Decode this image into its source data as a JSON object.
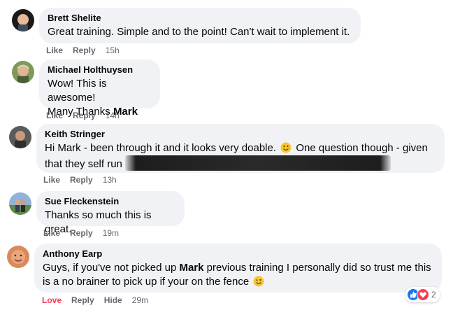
{
  "comments": [
    {
      "author": "Brett Shelite",
      "lines": [
        "Great training. Simple and to the point! Can't wait to implement it."
      ],
      "actions": {
        "like": "Like",
        "reply": "Reply",
        "time": "15h"
      }
    },
    {
      "author": "Michael Holthuysen",
      "line1": "Wow! This is awesome!",
      "line2_prefix": "Many Thanks ",
      "line2_mention": "Mark",
      "actions": {
        "like": "Like",
        "reply": "Reply",
        "time": "14h"
      }
    },
    {
      "author": "Keith Stringer",
      "line1_a": "Hi Mark - been through it and it looks very doable.",
      "line1_b": "One question though - given",
      "line2": "that they self run",
      "actions": {
        "like": "Like",
        "reply": "Reply",
        "time": "13h"
      }
    },
    {
      "author": "Sue Fleckenstein",
      "line1": "Thanks so much this is great.",
      "actions": {
        "like": "Like",
        "reply": "Reply",
        "time": "19m"
      }
    },
    {
      "author": "Anthony Earp",
      "line1_a": "Guys, if you've not picked up ",
      "line1_mention": "Mark",
      "line1_b": " previous training I personally did so trust me this",
      "line2": "is a no brainer to pick up if your on the fence",
      "actions": {
        "like": "Love",
        "reply": "Reply",
        "hide": "Hide",
        "time": "29m"
      },
      "reactions": {
        "icons": [
          "like-icon",
          "love-icon"
        ],
        "count": "2"
      }
    }
  ],
  "colors": {
    "bubble": "#f0f2f5",
    "meta": "#65676b",
    "love": "#f33e58",
    "like_blue": "#1877f2"
  }
}
